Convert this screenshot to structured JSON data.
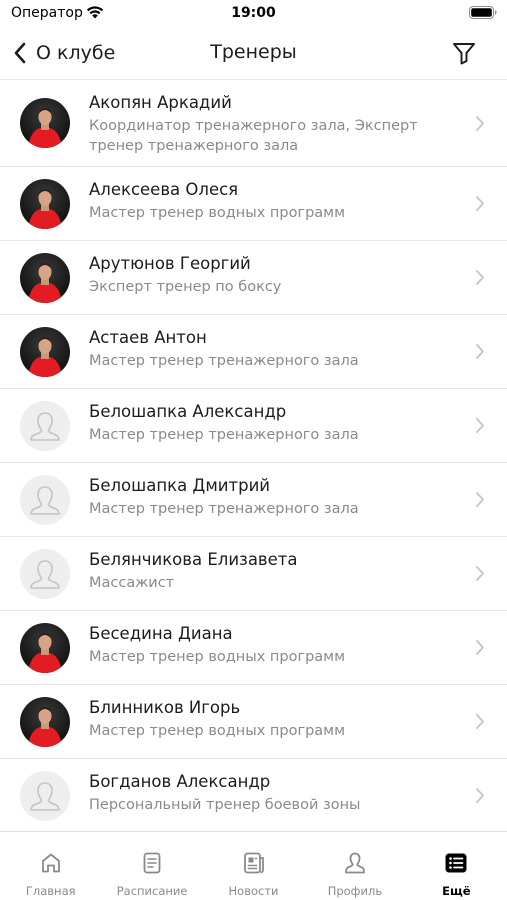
{
  "status_bar": {
    "carrier": "Оператор",
    "time": "19:00"
  },
  "nav": {
    "back_label": "О клубе",
    "title": "Тренеры"
  },
  "trainers": [
    {
      "name": "Акопян Аркадий",
      "role": "Координатор тренажерного зала, Эксперт тренер тренажерного зала",
      "has_photo": true
    },
    {
      "name": "Алексеева Олеся",
      "role": "Мастер тренер водных программ",
      "has_photo": true
    },
    {
      "name": "Арутюнов Георгий",
      "role": "Эксперт тренер по боксу",
      "has_photo": true
    },
    {
      "name": "Астаев Антон",
      "role": "Мастер тренер тренажерного зала",
      "has_photo": true
    },
    {
      "name": "Белошапка Александр",
      "role": "Мастер тренер тренажерного зала",
      "has_photo": false
    },
    {
      "name": "Белошапка Дмитрий",
      "role": "Мастер тренер тренажерного зала",
      "has_photo": false
    },
    {
      "name": "Белянчикова Елизавета",
      "role": "Массажист",
      "has_photo": false
    },
    {
      "name": "Беседина Диана",
      "role": "Мастер тренер водных программ",
      "has_photo": true
    },
    {
      "name": "Блинников Игорь",
      "role": "Мастер тренер водных программ",
      "has_photo": true
    },
    {
      "name": "Богданов Александр",
      "role": "Персональный тренер боевой зоны",
      "has_photo": false
    }
  ],
  "tabs": [
    {
      "label": "Главная",
      "icon": "home-icon",
      "active": false
    },
    {
      "label": "Расписание",
      "icon": "schedule-icon",
      "active": false
    },
    {
      "label": "Новости",
      "icon": "news-icon",
      "active": false
    },
    {
      "label": "Профиль",
      "icon": "profile-icon",
      "active": false
    },
    {
      "label": "Ещё",
      "icon": "more-list-icon",
      "active": true
    }
  ],
  "colors": {
    "accent_shirt": "#e31b23",
    "placeholder_avatar": "#eeeeee",
    "secondary_text": "#8a8a8e"
  }
}
